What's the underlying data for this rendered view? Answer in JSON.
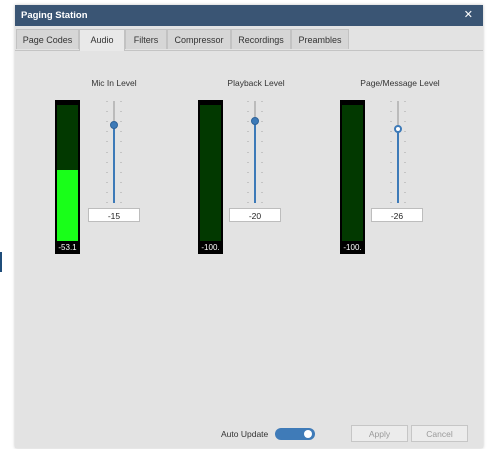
{
  "window": {
    "title": "Paging Station",
    "close_glyph": "✕"
  },
  "tabs": [
    {
      "label": "Page Codes",
      "active": false
    },
    {
      "label": "Audio",
      "active": true
    },
    {
      "label": "Filters",
      "active": false
    },
    {
      "label": "Compressor",
      "active": false
    },
    {
      "label": "Recordings",
      "active": false
    },
    {
      "label": "Preambles",
      "active": false
    }
  ],
  "channels": [
    {
      "label": "Mic In Level",
      "meter_text": "-53.1",
      "meter_fill_fraction": 0.52,
      "slider_value": "-15",
      "slider_fraction": 0.76,
      "thumb_style": "solid"
    },
    {
      "label": "Playback Level",
      "meter_text": "-100.",
      "meter_fill_fraction": 0,
      "slider_value": "-20",
      "slider_fraction": 0.8,
      "thumb_style": "solid"
    },
    {
      "label": "Page/Message Level",
      "meter_text": "-100.",
      "meter_fill_fraction": 0,
      "slider_value": "-26",
      "slider_fraction": 0.73,
      "thumb_style": "ring"
    }
  ],
  "footer": {
    "auto_update_label": "Auto Update",
    "auto_update_on": true,
    "apply_label": "Apply",
    "cancel_label": "Cancel"
  },
  "colors": {
    "titlebar": "#3a5574",
    "meter_active": "#19ff19",
    "meter_idle": "#023900",
    "accent": "#3d7ab8"
  }
}
